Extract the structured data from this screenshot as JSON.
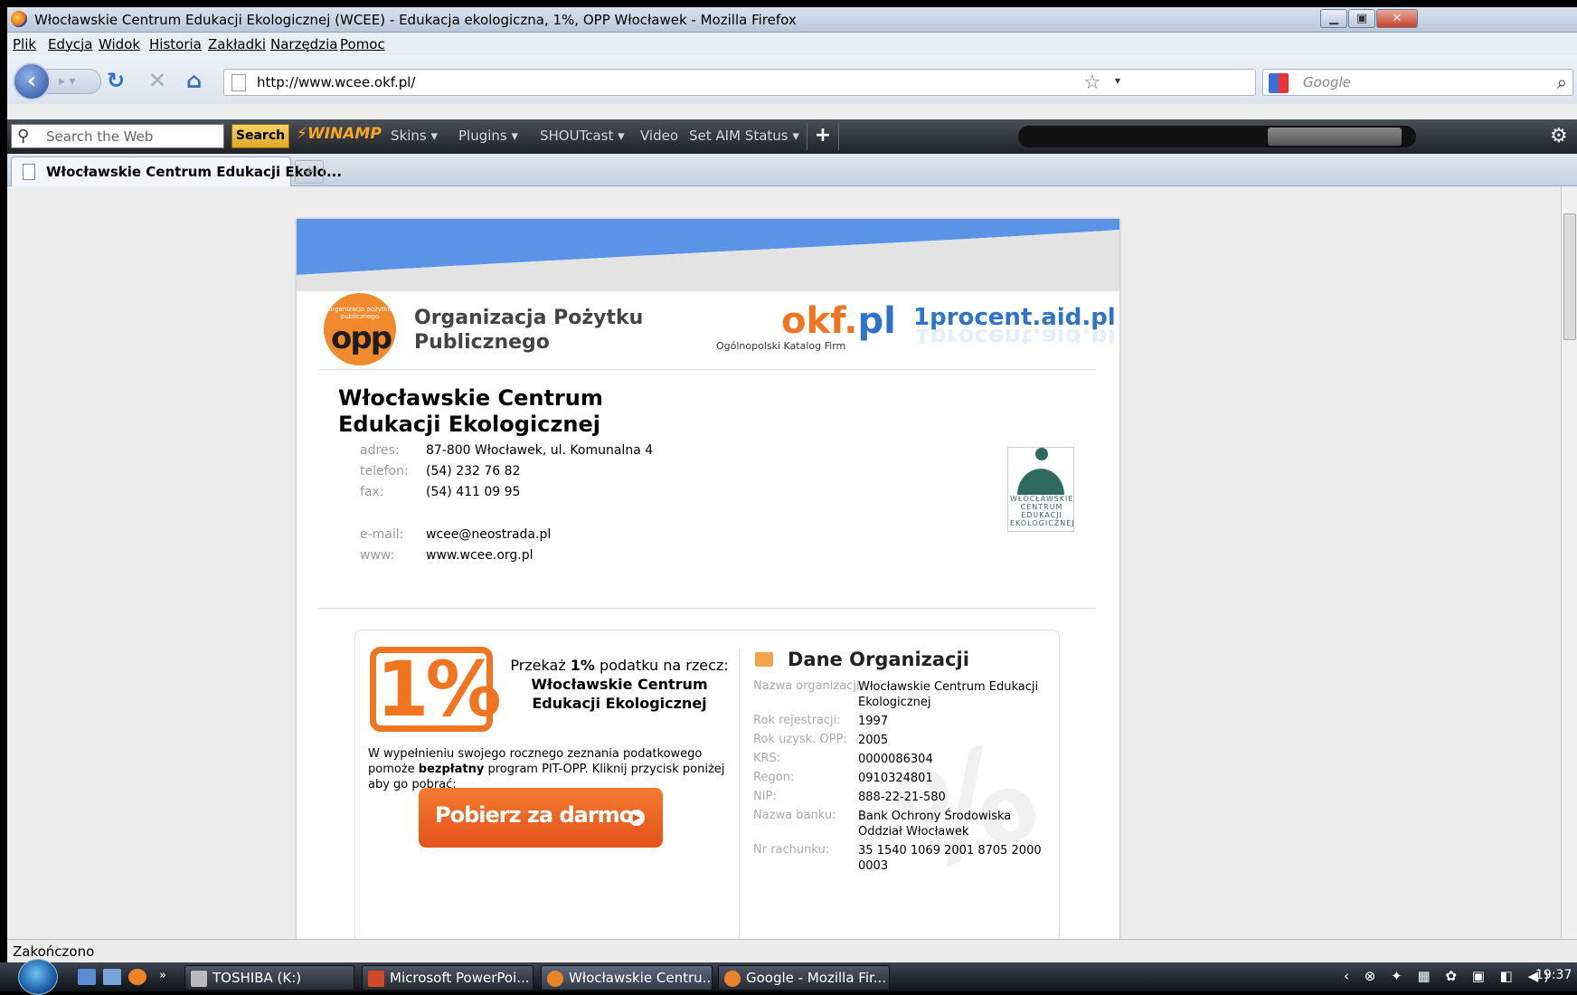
{
  "window": {
    "title": "Włocławskie Centrum Edukacji Ekologicznej (WCEE) - Edukacja ekologiczna, 1%, OPP Włocławek - Mozilla Firefox"
  },
  "menu": [
    "Plik",
    "Edycja",
    "Widok",
    "Historia",
    "Zakładki",
    "Narzędzia",
    "Pomoc"
  ],
  "nav": {
    "url": "http://www.wcee.okf.pl/",
    "search_placeholder": "Google"
  },
  "toolbar": {
    "search_placeholder": "Search the Web",
    "search_button": "Search",
    "brand": "WINAMP",
    "items": [
      "Skins ▾",
      "Plugins ▾",
      "SHOUTcast ▾",
      "Video",
      "Set AIM Status ▾"
    ]
  },
  "tabs": [
    {
      "label": "Włocławskie Centrum Edukacji Ekolo..."
    }
  ],
  "status": "Zakończono",
  "page": {
    "opp_badge": "opp",
    "opp_small": "organizacja pożytku publicznego",
    "opp_title_1": "Organizacja Pożytku",
    "opp_title_2": "Publicznego",
    "okf_a": "okf.",
    "okf_b": "pl",
    "okf_sub": "Ogólnopolski Katalog Firm",
    "procent": "1procent.aid.pl",
    "org_title": "Włocławskie Centrum Edukacji Ekologicznej",
    "contact": [
      {
        "label": "adres:",
        "value": "87-800 Włocławek, ul. Komunalna 4"
      },
      {
        "label": "telefon:",
        "value": "(54) 232 76 82"
      },
      {
        "label": "fax:",
        "value": "(54) 411 09 95"
      },
      {
        "label": "e-mail:",
        "value": "wcee@neostrada.pl"
      },
      {
        "label": "www:",
        "value": "www.wcee.org.pl"
      }
    ],
    "wcee_logo_text": "WŁOCŁAWSKIE CENTRUM EDUKACJI EKOLOGICZNEJ",
    "one_percent": "1%",
    "przekaz_pre": "Przekaż ",
    "przekaz_bold": "1%",
    "przekaz_post": " podatku na rzecz:",
    "przekaz_org": "Włocławskie Centrum Edukacji Ekologicznej",
    "wyp_text": "W wypełnieniu swojego rocznego zeznania podatkowego pomoże ",
    "wyp_bold": "bezpłatny",
    "wyp_text2": " program PIT-OPP. Kliknij przycisk poniżej aby go pobrać:",
    "download_button": "Pobierz za darmo PIT-OPP",
    "dane_title": "Dane Organizacji",
    "dane": [
      {
        "label": "Nazwa organizacji:",
        "value": "Włocławskie Centrum Edukacji Ekologicznej"
      },
      {
        "label": "Rok rejestracji:",
        "value": "1997"
      },
      {
        "label": "Rok uzysk. OPP:",
        "value": "2005"
      },
      {
        "label": "KRS:",
        "value": "0000086304"
      },
      {
        "label": "Regon:",
        "value": "0910324801"
      },
      {
        "label": "NIP:",
        "value": "888-22-21-580"
      },
      {
        "label": "Nazwa banku:",
        "value": "Bank Ochrony Środowiska Oddział Włocławek"
      },
      {
        "label": "Nr rachunku:",
        "value": "35 1540 1069 2001 8705 2000 0003"
      }
    ]
  },
  "taskbar": {
    "tasks": [
      "TOSHIBA (K:)",
      "Microsoft PowerPoi...",
      "Włocławskie Centru...",
      "Google - Mozilla Fir..."
    ],
    "clock": "19:37"
  }
}
